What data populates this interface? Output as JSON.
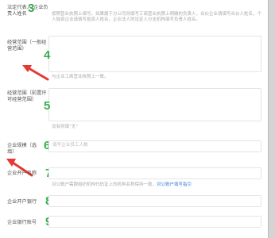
{
  "fields": [
    {
      "label": "法定代表人/企业负责人姓名",
      "number": "3",
      "hint": "按照营业执照上填写。如果属于分公司则填写工商营业执照上明确的负责人，合伙企业请填写合伙人姓名，个人独资企业请填写投资人姓名，企业法人的法定人分支机构填写负责人姓名。"
    },
    {
      "label": "经营范围（一般经营范围）",
      "number": "4",
      "hint": "与企业工商营业执照上一致。"
    },
    {
      "label": "经营范围（前置许可经营范围）",
      "number": "5",
      "hint": "没有则填“无”"
    },
    {
      "label": "企业规模（选填）",
      "number": "6",
      "placeholder": "填写企业员工人数"
    },
    {
      "label": "企业开户名称",
      "number": "7",
      "hint_prefix": "对公账户需跟组织机构代码证上的机构名称保持一致，",
      "hint_link": "对公账户填写指引"
    },
    {
      "label": "企业开户银行",
      "number": "8"
    },
    {
      "label": "企业银行账号",
      "number": "9"
    }
  ],
  "colors": {
    "number_green": "#33b04a",
    "arrow_red": "#e53935",
    "link_blue": "#3a7bd5"
  }
}
